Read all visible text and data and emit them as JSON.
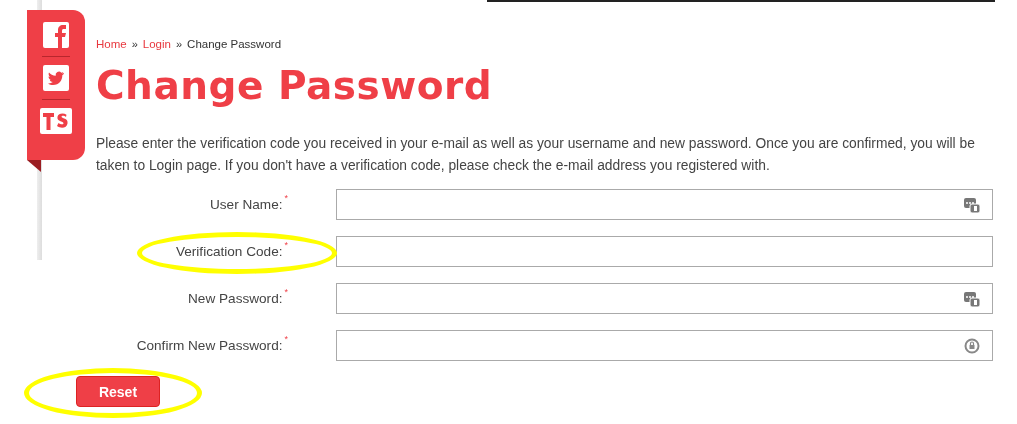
{
  "social_bar": [
    {
      "kind": "facebook"
    },
    {
      "kind": "twitter"
    },
    {
      "kind": "ts"
    }
  ],
  "breadcrumb": [
    {
      "label": "Home",
      "link": true
    },
    {
      "label": "Login",
      "link": true
    },
    {
      "label": "Change Password",
      "link": false
    }
  ],
  "breadcrumb_separator": "»",
  "title": "Change Password",
  "intro": "Please enter the verification code you received in your e-mail as well as your username and new password. Once you are confirmed, you will be taken to Login page. If you don't have a verification code, please check the e-mail address you registered with.",
  "fields": [
    {
      "label": "User Name:",
      "required": true,
      "kind": "keypad",
      "highlighted": false
    },
    {
      "label": "Verification Code:",
      "required": true,
      "kind": "plain",
      "highlighted": true
    },
    {
      "label": "New Password:",
      "required": true,
      "kind": "keypad",
      "highlighted": false
    },
    {
      "label": "Confirm New Password:",
      "required": true,
      "kind": "lock",
      "highlighted": false
    }
  ],
  "required_mark": "*",
  "reset_button": {
    "label": "Reset",
    "highlighted": true
  }
}
